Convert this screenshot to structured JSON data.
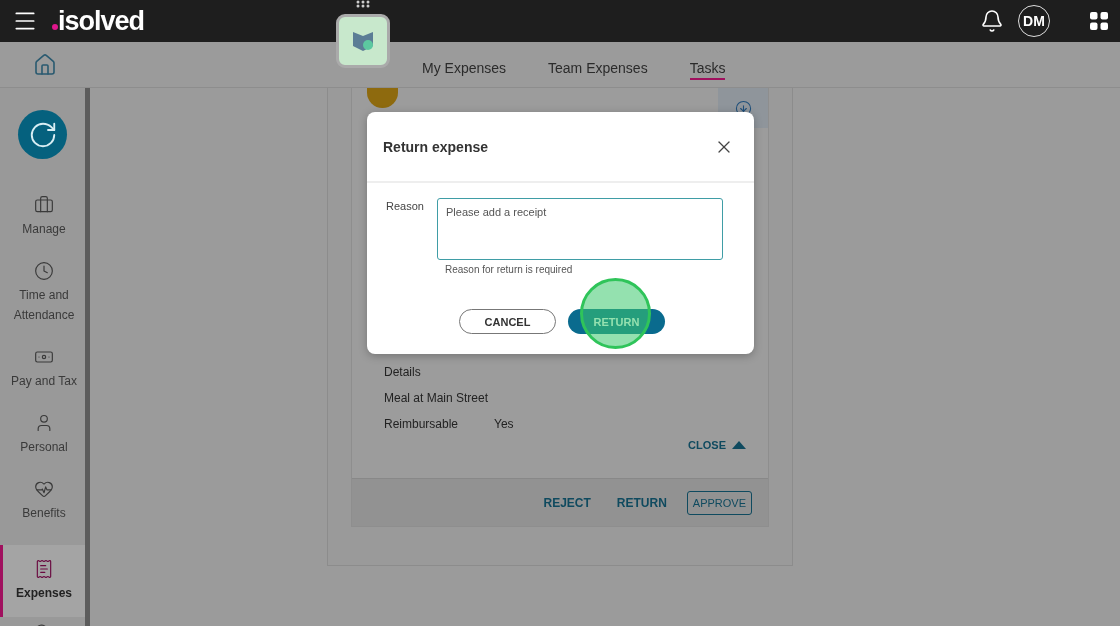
{
  "header": {
    "logo": "isolved",
    "avatar": "DM"
  },
  "tabs": [
    {
      "label": "My Expenses",
      "selected": false
    },
    {
      "label": "Team Expenses",
      "selected": false
    },
    {
      "label": "Tasks",
      "selected": true
    }
  ],
  "sidebar": {
    "items": [
      {
        "label": "Manage",
        "selected": false
      },
      {
        "label": "Time and Attendance",
        "selected": false
      },
      {
        "label": "Pay and Tax",
        "selected": false
      },
      {
        "label": "Personal",
        "selected": false
      },
      {
        "label": "Benefits",
        "selected": false
      },
      {
        "label": "Expenses",
        "selected": true
      },
      {
        "selected": false
      }
    ]
  },
  "expense": {
    "rows": [
      {
        "label": "Details"
      },
      {
        "label": "Meal at Main Street"
      },
      {
        "label": "Reimbursable",
        "value": "Yes"
      }
    ],
    "toggle": "CLOSE",
    "actions": [
      "REJECT",
      "RETURN"
    ],
    "primary": "APPROVE"
  },
  "dialog": {
    "title": "Return expense",
    "field_label": "Reason",
    "value": "Please add a receipt",
    "error": "Reason for return is required",
    "buttons": [
      {
        "label": "CANCEL",
        "kind": "outline"
      },
      {
        "label": "RETURN",
        "kind": "filled"
      }
    ]
  }
}
